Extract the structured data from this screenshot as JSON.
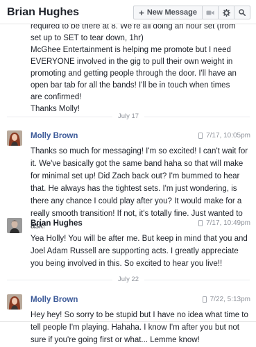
{
  "header": {
    "title": "Brian Hughes",
    "new_message_label": "New Message",
    "icons": [
      "plus-icon",
      "video-icon",
      "gear-icon",
      "search-icon"
    ]
  },
  "thread": {
    "partial_message": {
      "lines": [
        "required to be there at 8. We're all doing an hour set (from",
        "set up to SET to tear down, 1hr)",
        "McGhee Entertainment is helping me promote but I need",
        "EVERYONE involved in the gig to pull their own weight in",
        "promoting and getting people through the door. I'll have an",
        "open bar tab for all the bands! I'll be in touch when times",
        "are confirmed!",
        "Thanks Molly!"
      ]
    },
    "dividers": [
      {
        "label": "July 17"
      },
      {
        "label": "July 22"
      }
    ],
    "messages": [
      {
        "sender": "Molly Brown",
        "time": "7/17, 10:05pm",
        "body": "Thanks so much for messaging! I'm so excited! I can't wait for it. We've basically got the same band haha so that will make for minimal set up! Did Zach back out? I'm bummed to hear that. He always has the tightest sets. I'm just wondering, is there any chance I could play after you? It would make for a really smooth transition! If not, it's totally fine. Just wanted to ask!"
      },
      {
        "sender": "Brian Hughes",
        "time": "7/17, 10:49pm",
        "body": "Yea Holly! You will be after me. But keep in mind that you and Joel Adam Russell are supporting acts. I greatly appreciate you being involved in this. So excited to hear you live!!"
      },
      {
        "sender": "Molly Brown",
        "time": "7/22, 5:13pm",
        "body": "Hey hey! So sorry to be stupid but I have no idea what time to tell people I'm playing. Hahaha. I know I'm after you but not sure if you're going first or what... Lemme know!"
      }
    ]
  },
  "colors": {
    "link_blue": "#3b5998",
    "meta_gray": "#90949c",
    "divider_gray": "#e9ebee"
  }
}
